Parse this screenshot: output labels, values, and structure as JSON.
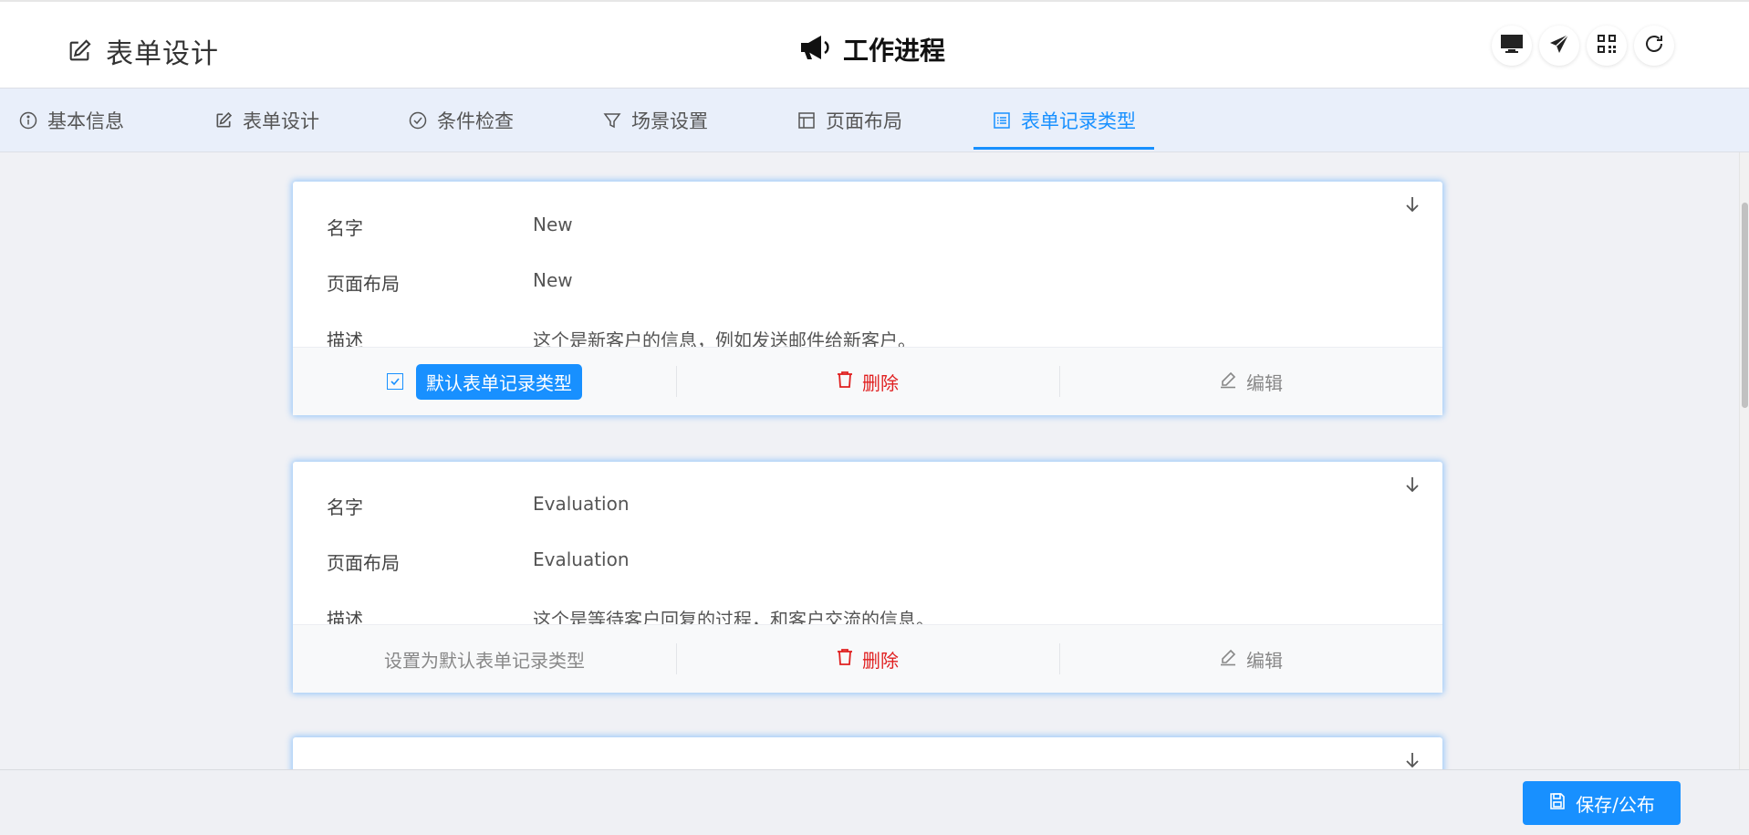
{
  "header": {
    "left_title": "表单设计",
    "center_title": "工作进程"
  },
  "header_actions": [
    {
      "icon": "monitor-icon"
    },
    {
      "icon": "send-icon"
    },
    {
      "icon": "qrcode-icon"
    },
    {
      "icon": "refresh-icon"
    }
  ],
  "tabs": [
    {
      "label": "基本信息",
      "icon": "info-icon"
    },
    {
      "label": "表单设计",
      "icon": "edit-icon"
    },
    {
      "label": "条件检查",
      "icon": "check-circle-icon"
    },
    {
      "label": "场景设置",
      "icon": "filter-icon"
    },
    {
      "label": "页面布局",
      "icon": "layout-icon"
    },
    {
      "label": "表单记录类型",
      "icon": "list-icon",
      "active": true
    }
  ],
  "labels": {
    "name": "名字",
    "layout": "页面布局",
    "description": "描述"
  },
  "record_types": [
    {
      "name": "New",
      "layout": "New",
      "description": "这个是新客户的信息，例如发送邮件给新客户。",
      "is_default": true,
      "default_label": "默认表单记录类型",
      "delete_label": "删除",
      "edit_label": "编辑"
    },
    {
      "name": "Evaluation",
      "layout": "Evaluation",
      "description": "这个是等待客户回复的过程，和客户交流的信息。",
      "is_default": false,
      "default_label": "设置为默认表单记录类型",
      "delete_label": "删除",
      "edit_label": "编辑"
    }
  ],
  "footer": {
    "save_label": "保存/公布"
  },
  "colors": {
    "accent": "#1890ff",
    "danger": "#e02020",
    "tab_bar": "#e9effa"
  }
}
